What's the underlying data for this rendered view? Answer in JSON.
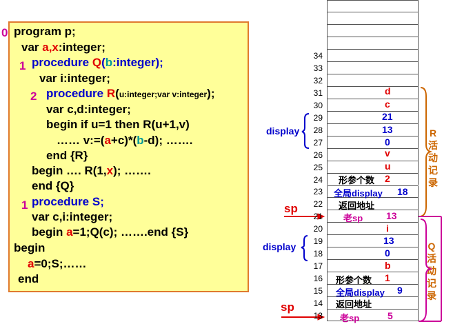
{
  "code": {
    "level0": "0",
    "line_program": "program p;",
    "line_var_pre": "var ",
    "line_var_ax": "a,x",
    "line_var_post": ":integer;",
    "level1a": "1",
    "line_procQ_pre": "procedure ",
    "line_procQ_name": "Q",
    "line_procQ_paren": "(",
    "line_procQ_param": "b",
    "line_procQ_post": ":integer);",
    "line_var_i": "var i:integer;",
    "level2": "2",
    "line_procR_pre": "procedure ",
    "line_procR_name": "R",
    "line_procR_paren": "(",
    "line_procR_params": "u:integer;var v:integer",
    "line_procR_post": ");",
    "line_var_cd": "var c,d:integer;",
    "line_begin_if": "begin     if  u=1 then R(u+1,v)",
    "line_assign_pre": "……       v:=(",
    "line_assign_a": "a",
    "line_assign_mid": "+c)*(",
    "line_assign_b": "b",
    "line_assign_post": "-d);    …….",
    "line_end_R": "end {R}",
    "line_beginQ_pre": "begin ….   R(1,",
    "line_beginQ_x": "x",
    "line_beginQ_post": ");  …….",
    "line_end_Q": "end {Q}",
    "level1b": "1",
    "line_procS": "procedure S;",
    "line_var_ci": "var c,i:integer;",
    "line_beginS_pre": "begin   ",
    "line_beginS_a": "a",
    "line_beginS_post": "=1;Q(c); …….end {S}",
    "line_begin_main": "begin",
    "line_main_a": "a",
    "line_main_post": "=0;S;……",
    "line_end_main": "end"
  },
  "stack": {
    "addresses": [
      "34",
      "33",
      "32",
      "31",
      "30",
      "29",
      "28",
      "27",
      "26",
      "25",
      "24",
      "23",
      "22",
      "21",
      "20",
      "19",
      "18",
      "17",
      "16",
      "15",
      "14",
      "13"
    ],
    "cells": {
      "c31": "d",
      "c30": "c",
      "c29": "21",
      "c28": "13",
      "c27": "0",
      "c26": "v",
      "c25": "u",
      "c24_label": "形参个数",
      "c24_val": "2",
      "c23_label": "全局display",
      "c23_val": "18",
      "c22": "返回地址",
      "c21_label": "老sp",
      "c21_val": "13",
      "c20": "i",
      "c19": "13",
      "c18": "0",
      "c17": "b",
      "c16_label": "形参个数",
      "c16_val": "1",
      "c15_label": "全局display",
      "c15_val": "9",
      "c14": "返回地址",
      "c13_label": "老sp",
      "c13_val": "5"
    },
    "display_label_upper": "display",
    "display_label_lower": "display",
    "sp_upper": "sp",
    "sp_lower": "sp",
    "record_R": "R活动记录",
    "record_Q": "Q活动记录"
  }
}
